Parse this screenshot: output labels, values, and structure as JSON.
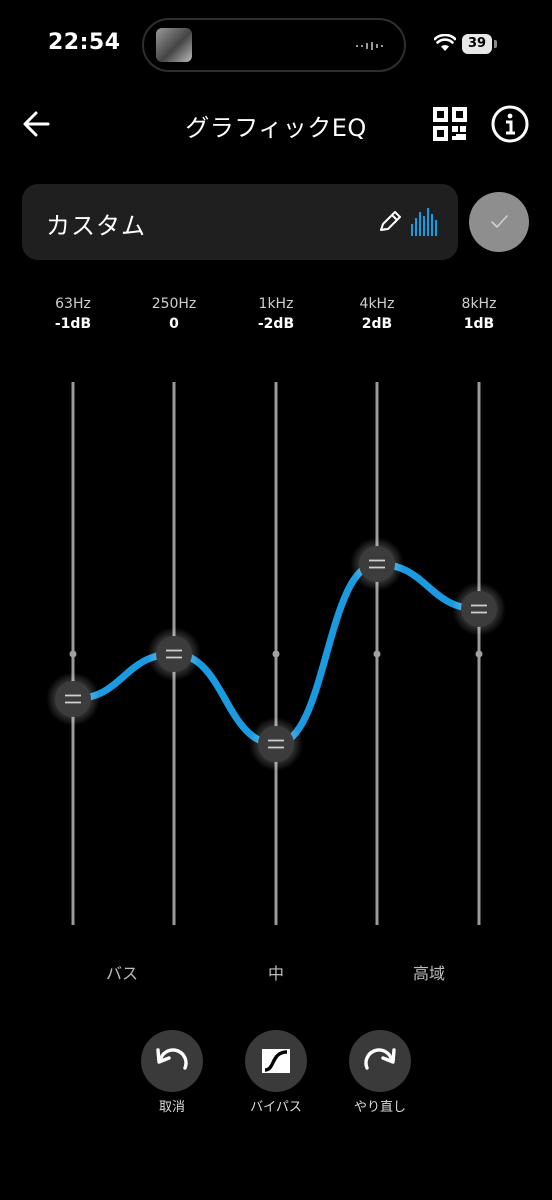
{
  "status_bar": {
    "time": "22:54",
    "battery": "39"
  },
  "header": {
    "title": "グラフィックEQ"
  },
  "preset": {
    "name": "カスタム"
  },
  "colors": {
    "accent": "#1a9ae0",
    "card": "#1f1f1f",
    "button": "#3a3a3a"
  },
  "bands": [
    {
      "freq": "63Hz",
      "gain_label": "-1dB",
      "gain": -1
    },
    {
      "freq": "250Hz",
      "gain_label": "0",
      "gain": 0
    },
    {
      "freq": "1kHz",
      "gain_label": "-2dB",
      "gain": -2
    },
    {
      "freq": "4kHz",
      "gain_label": "2dB",
      "gain": 2
    },
    {
      "freq": "8kHz",
      "gain_label": "1dB",
      "gain": 1
    }
  ],
  "regions": {
    "bass": "バス",
    "mid": "中",
    "treble": "高域"
  },
  "controls": {
    "undo": "取消",
    "bypass": "バイパス",
    "redo": "やり直し"
  },
  "icons": {
    "back": "arrow-left-icon",
    "qr": "qr-code-icon",
    "info": "info-icon",
    "edit": "pencil-icon",
    "eq": "equalizer-bars-icon",
    "confirm": "checkmark-icon",
    "undo": "undo-arrow-icon",
    "bypass": "bypass-logo-icon",
    "redo": "redo-arrow-icon"
  }
}
